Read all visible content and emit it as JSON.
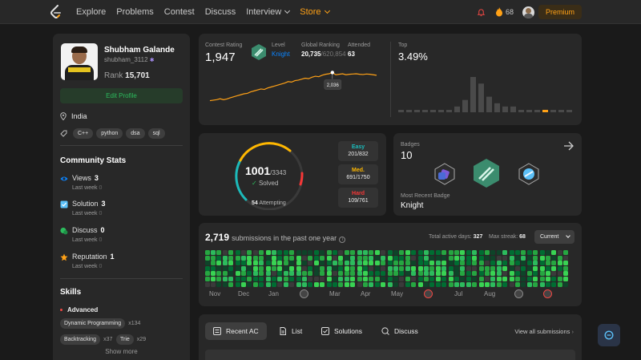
{
  "nav": {
    "links": [
      "Explore",
      "Problems",
      "Contest",
      "Discuss",
      "Interview",
      "Store"
    ],
    "streak": "68",
    "premium": "Premium"
  },
  "profile": {
    "name": "Shubham Galande",
    "username": "shubham_3112",
    "rank_label": "Rank",
    "rank": "15,701",
    "edit": "Edit Profile",
    "location": "India",
    "tags": [
      "C++",
      "python",
      "dsa",
      "sql"
    ]
  },
  "community": {
    "title": "Community Stats",
    "items": [
      {
        "label": "Views",
        "value": "3",
        "sub": "Last week",
        "sub_val": "0",
        "color": "#0a84ff"
      },
      {
        "label": "Solution",
        "value": "3",
        "sub": "Last week",
        "sub_val": "0",
        "color": "#5bc0f8"
      },
      {
        "label": "Discuss",
        "value": "0",
        "sub": "Last week",
        "sub_val": "0",
        "color": "#2cbb5d"
      },
      {
        "label": "Reputation",
        "value": "1",
        "sub": "Last week",
        "sub_val": "0",
        "color": "#ffa116"
      }
    ]
  },
  "skills": {
    "title": "Skills",
    "level": "Advanced",
    "items": [
      {
        "name": "Dynamic Programming",
        "count": "x134"
      },
      {
        "name": "Backtracking",
        "count": "x37"
      },
      {
        "name": "Trie",
        "count": "x29"
      }
    ],
    "show_more": "Show more"
  },
  "contest": {
    "rating_label": "Contest Rating",
    "rating": "1,947",
    "level_label": "Level",
    "level": "Knight",
    "global_label": "Global Ranking",
    "global_rank": "20,735",
    "global_total": "/620,854",
    "attended_label": "Attended",
    "attended": "63",
    "tooltip": "2,036",
    "top_label": "Top",
    "top_value": "3.49%",
    "line_series": [
      1460,
      1470,
      1480,
      1500,
      1480,
      1495,
      1520,
      1540,
      1560,
      1580,
      1600,
      1610,
      1640,
      1660,
      1680,
      1700,
      1690,
      1720,
      1740,
      1760,
      1780,
      1800,
      1820,
      1850,
      1840,
      1870,
      1880,
      1900,
      1920,
      1910,
      1940,
      1960,
      1950,
      1980,
      2000,
      2010,
      2036,
      1990,
      2000,
      2010,
      1990,
      2000,
      2005,
      2010,
      2000,
      1995,
      2005,
      2000,
      1990,
      1980
    ],
    "histogram": [
      0,
      0,
      0,
      0,
      0,
      0,
      0,
      1,
      3,
      10,
      8,
      4,
      2,
      1,
      1,
      0,
      0,
      0,
      0,
      0,
      0,
      0
    ],
    "histogram_highlight": 18
  },
  "solved": {
    "count": "1001",
    "total": "/3343",
    "solved_label": "Solved",
    "attempting_count": "54",
    "attempting_label": "Attempting",
    "easy_label": "Easy",
    "easy": "201/832",
    "med_label": "Med.",
    "med": "691/1750",
    "hard_label": "Hard",
    "hard": "109/761",
    "colors": {
      "easy": "#1cbaba",
      "med": "#ffb700",
      "hard": "#f63737"
    }
  },
  "badges": {
    "label": "Badges",
    "count": "10",
    "recent_label": "Most Recent Badge",
    "recent": "Knight"
  },
  "submissions": {
    "count": "2,719",
    "text": "submissions in the past one year",
    "active_label": "Total active days:",
    "active": "327",
    "streak_label": "Max streak:",
    "streak": "68",
    "current": "Current",
    "months": [
      "Nov",
      "Dec",
      "Jan",
      "Mar",
      "Apr",
      "May",
      "Jul",
      "Aug"
    ]
  },
  "bottom": {
    "tabs": [
      "Recent AC",
      "List",
      "Solutions",
      "Discuss"
    ],
    "view_all": "View all submissions"
  }
}
